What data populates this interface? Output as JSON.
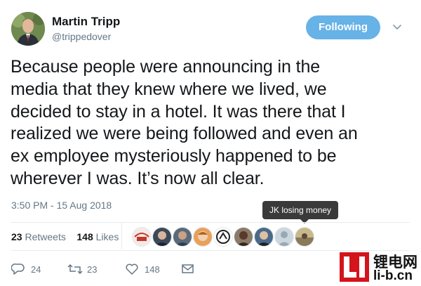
{
  "author": {
    "name": "Martin Tripp",
    "handle": "@trippedover"
  },
  "follow_button": {
    "label": "Following"
  },
  "tweet": {
    "text": "Because people were announcing in the\nmedia that they knew where we lived, we\ndecided to stay in a hotel.  It was there that I\nrealized we were being followed and even an\nex employee mysteriously happened to be\nwherever I was.  It’s now all clear.",
    "timestamp": "3:50 PM - 15 Aug 2018"
  },
  "tooltip": {
    "text": "JK losing money"
  },
  "stats": {
    "retweets_count": "23",
    "retweets_label": "Retweets",
    "likes_count": "148",
    "likes_label": "Likes"
  },
  "actions": {
    "reply_count": "24",
    "retweet_count": "23",
    "like_count": "148"
  },
  "watermark": {
    "top": "锂电网",
    "bottom": "li-b.cn"
  },
  "colors": {
    "follow_button": "#67b2e6",
    "text": "#14171a",
    "muted": "#657786",
    "watermark_red": "#d4141c"
  }
}
